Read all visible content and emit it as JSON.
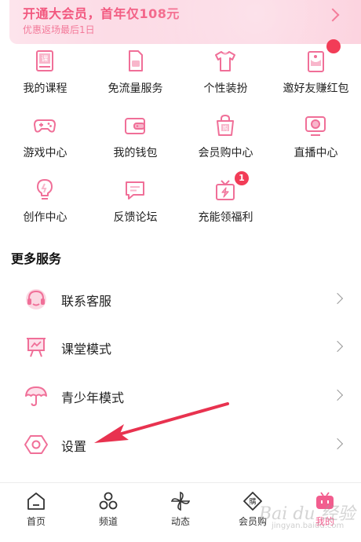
{
  "vip_banner": {
    "title": "开通大会员，首年仅108元",
    "subtitle": "优惠返场最后1日"
  },
  "services": [
    {
      "label": "我的课程",
      "icon": "course-icon"
    },
    {
      "label": "免流量服务",
      "icon": "sim-card-icon"
    },
    {
      "label": "个性装扮",
      "icon": "tshirt-icon"
    },
    {
      "label": "邀好友赚红包",
      "icon": "invite-icon",
      "badge": ""
    },
    {
      "label": "游戏中心",
      "icon": "gamepad-icon"
    },
    {
      "label": "我的钱包",
      "icon": "wallet-icon"
    },
    {
      "label": "会员购中心",
      "icon": "shopping-bag-icon"
    },
    {
      "label": "直播中心",
      "icon": "live-tv-icon"
    },
    {
      "label": "创作中心",
      "icon": "lightbulb-icon"
    },
    {
      "label": "反馈论坛",
      "icon": "feedback-icon"
    },
    {
      "label": "充能领福利",
      "icon": "gift-icon",
      "badge": "1"
    }
  ],
  "more_services": {
    "title": "更多服务",
    "items": [
      {
        "label": "联系客服",
        "icon": "headset-icon"
      },
      {
        "label": "课堂模式",
        "icon": "classroom-icon"
      },
      {
        "label": "青少年模式",
        "icon": "umbrella-icon"
      },
      {
        "label": "设置",
        "icon": "settings-icon"
      }
    ]
  },
  "tabbar": [
    {
      "label": "首页",
      "icon": "home-icon"
    },
    {
      "label": "频道",
      "icon": "channels-icon"
    },
    {
      "label": "动态",
      "icon": "pinwheel-icon"
    },
    {
      "label": "会员购",
      "icon": "vip-shop-icon"
    },
    {
      "label": "我的",
      "icon": "tv-icon",
      "active": true
    }
  ],
  "watermark": {
    "text": "Bai du 经验",
    "sub": "jingyan.baidu.com"
  },
  "colors": {
    "accent": "#f25d8e",
    "badge": "#f23c57",
    "banner_text": "#f2587f",
    "arrow": "#e8324f"
  }
}
